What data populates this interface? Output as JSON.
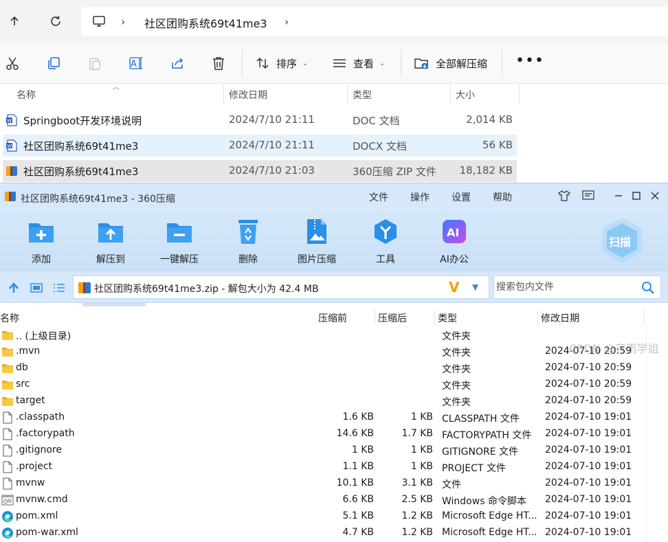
{
  "explorer": {
    "breadcrumb": "社区团购系统69t41me3",
    "commands": {
      "sort": "排序",
      "view": "查看",
      "extract_all": "全部解压缩",
      "more": "•••"
    },
    "columns": {
      "name": "名称",
      "modified": "修改日期",
      "type": "类型",
      "size": "大小"
    },
    "files": [
      {
        "name": "Springboot开发环境说明",
        "modified": "2024/7/10 21:11",
        "type": "DOC 文档",
        "size": "2,014 KB",
        "icon": "word-doc-icon",
        "selected": "none"
      },
      {
        "name": "社区团购系统69t41me3",
        "modified": "2024/7/10 21:11",
        "type": "DOCX 文档",
        "size": "56 KB",
        "icon": "word-docx-icon",
        "selected": "hover"
      },
      {
        "name": "社区团购系统69t41me3",
        "modified": "2024/7/10 21:03",
        "type": "360压缩 ZIP 文件",
        "size": "18,182 KB",
        "icon": "zip-archive-icon",
        "selected": "active"
      }
    ]
  },
  "zip_window": {
    "title": "社区团购系统69t41me3 - 360压缩",
    "menu": [
      "文件",
      "操作",
      "设置",
      "帮助"
    ],
    "tools": [
      {
        "label": "添加",
        "icon": "add-folder-icon"
      },
      {
        "label": "解压到",
        "icon": "extract-to-icon"
      },
      {
        "label": "一键解压",
        "icon": "one-click-extract-icon"
      },
      {
        "label": "删除",
        "icon": "recycle-delete-icon"
      },
      {
        "label": "图片压缩",
        "icon": "image-compress-icon"
      },
      {
        "label": "工具",
        "icon": "tools-icon"
      },
      {
        "label": "AI办公",
        "icon": "ai-office-icon"
      }
    ],
    "scan_label": "扫描",
    "path": "社区团购系统69t41me3.zip - 解包大小为 42.4 MB",
    "search_placeholder": "搜索包内文件",
    "columns": {
      "name": "名称",
      "compressed_before": "压缩前",
      "compressed_after": "压缩后",
      "type": "类型",
      "modified": "修改日期"
    },
    "entries": [
      {
        "name": ".. (上级目录)",
        "before": "",
        "after": "",
        "type": "文件夹",
        "modified": "",
        "icon": "folder-icon"
      },
      {
        "name": ".mvn",
        "before": "",
        "after": "",
        "type": "文件夹",
        "modified": "2024-07-10 20:59",
        "icon": "folder-icon"
      },
      {
        "name": "db",
        "before": "",
        "after": "",
        "type": "文件夹",
        "modified": "2024-07-10 20:59",
        "icon": "folder-icon"
      },
      {
        "name": "src",
        "before": "",
        "after": "",
        "type": "文件夹",
        "modified": "2024-07-10 20:59",
        "icon": "folder-icon"
      },
      {
        "name": "target",
        "before": "",
        "after": "",
        "type": "文件夹",
        "modified": "2024-07-10 20:59",
        "icon": "folder-icon"
      },
      {
        "name": ".classpath",
        "before": "1.6 KB",
        "after": "1 KB",
        "type": "CLASSPATH 文件",
        "modified": "2024-07-10 19:01",
        "icon": "file-icon"
      },
      {
        "name": ".factorypath",
        "before": "14.6 KB",
        "after": "1.7 KB",
        "type": "FACTORYPATH 文件",
        "modified": "2024-07-10 19:01",
        "icon": "file-icon"
      },
      {
        "name": ".gitignore",
        "before": "1 KB",
        "after": "1 KB",
        "type": "GITIGNORE 文件",
        "modified": "2024-07-10 19:01",
        "icon": "file-icon"
      },
      {
        "name": ".project",
        "before": "1.1 KB",
        "after": "1 KB",
        "type": "PROJECT 文件",
        "modified": "2024-07-10 19:01",
        "icon": "file-icon"
      },
      {
        "name": "mvnw",
        "before": "10.1 KB",
        "after": "3.1 KB",
        "type": "文件",
        "modified": "2024-07-10 19:01",
        "icon": "file-icon"
      },
      {
        "name": "mvnw.cmd",
        "before": "6.6 KB",
        "after": "2.5 KB",
        "type": "Windows 命令脚本",
        "modified": "2024-07-10 19:01",
        "icon": "cmd-script-icon"
      },
      {
        "name": "pom.xml",
        "before": "5.1 KB",
        "after": "1.2 KB",
        "type": "Microsoft Edge HT...",
        "modified": "2024-07-10 19:01",
        "icon": "edge-icon"
      },
      {
        "name": "pom-war.xml",
        "before": "4.7 KB",
        "after": "1.2 KB",
        "type": "Microsoft Edge HT...",
        "modified": "2024-07-10 19:01",
        "icon": "edge-icon"
      }
    ]
  },
  "watermark": "CSDN @齐雨学姐",
  "colors": {
    "accent": "#1e88e5",
    "zip_bg": "#d6e8fa",
    "selected_row": "#e5f1fb"
  }
}
